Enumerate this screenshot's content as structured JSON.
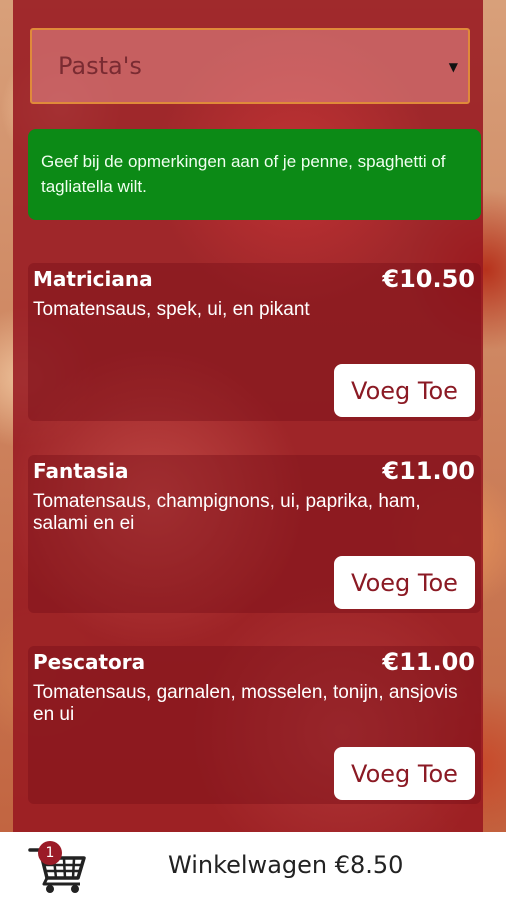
{
  "category_select": {
    "value": "Pasta's"
  },
  "notice": {
    "text": "Geef bij de opmerkingen aan of je penne, spaghetti of tagliatella wilt."
  },
  "products": [
    {
      "name": "Matriciana",
      "price": "€10.50",
      "description": "Tomatensaus, spek, ui, en pikant",
      "button": "Voeg Toe"
    },
    {
      "name": "Fantasia",
      "price": "€11.00",
      "description": "Tomatensaus, champignons, ui, paprika, ham, salami en ei",
      "button": "Voeg Toe"
    },
    {
      "name": "Pescatora",
      "price": "€11.00",
      "description": "Tomatensaus, garnalen, mosselen, tonijn, ansjovis en ui",
      "button": "Voeg Toe"
    }
  ],
  "cart": {
    "badge_count": "1",
    "label": "Winkelwagen €8.50"
  },
  "colors": {
    "panel": "#961620",
    "notice": "#0c8a16",
    "button_text": "#8b1a24"
  }
}
